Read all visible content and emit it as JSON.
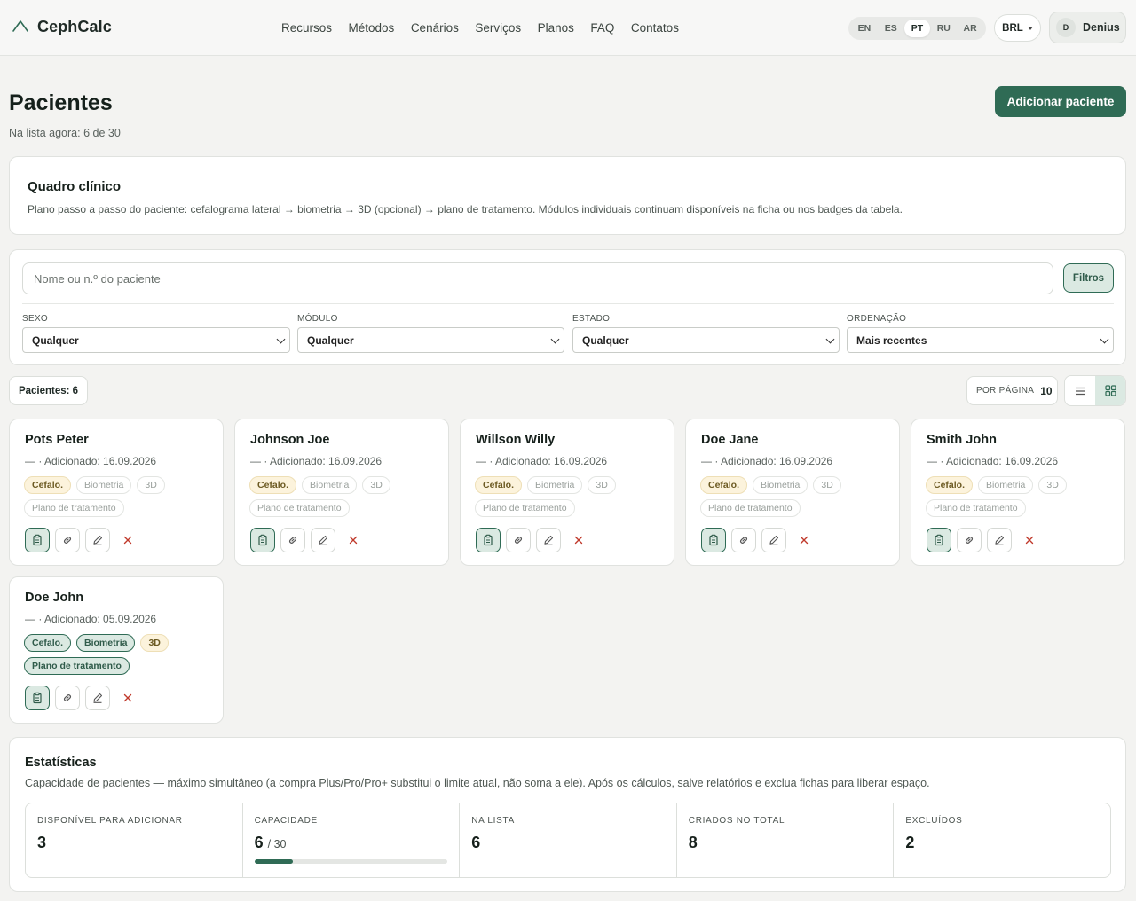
{
  "brand": {
    "name": "CephCalc"
  },
  "nav": [
    "Recursos",
    "Métodos",
    "Cenários",
    "Serviços",
    "Planos",
    "FAQ",
    "Contatos"
  ],
  "languages": {
    "items": [
      "EN",
      "ES",
      "PT",
      "RU",
      "AR"
    ],
    "active": "PT"
  },
  "currency": "BRL",
  "user": {
    "initial": "D",
    "name": "Denius"
  },
  "page": {
    "title": "Pacientes",
    "subtitle": "Na lista agora: 6 de 30",
    "add_button": "Adicionar paciente"
  },
  "clinical": {
    "title": "Quadro clínico",
    "text": "Plano passo a passo do paciente: cefalograma lateral → biometria → 3D (opcional) → plano de tratamento. Módulos individuais continuam disponíveis na ficha ou nos badges da tabela."
  },
  "filters": {
    "search_placeholder": "Nome ou n.º do paciente",
    "button": "Filtros",
    "sex": {
      "label": "SEXO",
      "value": "Qualquer"
    },
    "module": {
      "label": "MÓDULO",
      "value": "Qualquer"
    },
    "state": {
      "label": "ESTADO",
      "value": "Qualquer"
    },
    "order": {
      "label": "ORDENAÇÃO",
      "value": "Mais recentes"
    }
  },
  "list": {
    "count": "Pacientes: 6",
    "per_page_label": "POR PÁGINA",
    "per_page_value": "10",
    "view": "grid"
  },
  "patients": [
    {
      "name": "Pots Peter",
      "meta": "— · Adicionado: 16.09.2026",
      "badges": [
        {
          "label": "Cefalo.",
          "state": "warn"
        },
        {
          "label": "Biometria",
          "state": "off"
        },
        {
          "label": "3D",
          "state": "off"
        },
        {
          "label": "Plano de tratamento",
          "state": "off"
        }
      ]
    },
    {
      "name": "Johnson Joe",
      "meta": "— · Adicionado: 16.09.2026",
      "badges": [
        {
          "label": "Cefalo.",
          "state": "warn"
        },
        {
          "label": "Biometria",
          "state": "off"
        },
        {
          "label": "3D",
          "state": "off"
        },
        {
          "label": "Plano de tratamento",
          "state": "off"
        }
      ]
    },
    {
      "name": "Willson Willy",
      "meta": "— · Adicionado: 16.09.2026",
      "badges": [
        {
          "label": "Cefalo.",
          "state": "warn"
        },
        {
          "label": "Biometria",
          "state": "off"
        },
        {
          "label": "3D",
          "state": "off"
        },
        {
          "label": "Plano de tratamento",
          "state": "off"
        }
      ]
    },
    {
      "name": "Doe Jane",
      "meta": "— · Adicionado: 16.09.2026",
      "badges": [
        {
          "label": "Cefalo.",
          "state": "warn"
        },
        {
          "label": "Biometria",
          "state": "off"
        },
        {
          "label": "3D",
          "state": "off"
        },
        {
          "label": "Plano de tratamento",
          "state": "off"
        }
      ]
    },
    {
      "name": "Smith John",
      "meta": "— · Adicionado: 16.09.2026",
      "badges": [
        {
          "label": "Cefalo.",
          "state": "warn"
        },
        {
          "label": "Biometria",
          "state": "off"
        },
        {
          "label": "3D",
          "state": "off"
        },
        {
          "label": "Plano de tratamento",
          "state": "off"
        }
      ]
    },
    {
      "name": "Doe John",
      "meta": "— · Adicionado: 05.09.2026",
      "badges": [
        {
          "label": "Cefalo.",
          "state": "done"
        },
        {
          "label": "Biometria",
          "state": "done"
        },
        {
          "label": "3D",
          "state": "warn"
        },
        {
          "label": "Plano de tratamento",
          "state": "done"
        }
      ]
    }
  ],
  "stats": {
    "title": "Estatísticas",
    "text": "Capacidade de pacientes — máximo simultâneo (a compra Plus/Pro/Pro+ substitui o limite atual, não soma a ele). Após os cálculos, salve relatórios e exclua fichas para liberar espaço.",
    "cells": [
      {
        "label": "DISPONÍVEL PARA ADICIONAR",
        "value": "3"
      },
      {
        "label": "CAPACIDADE",
        "value": "6",
        "sub": "/ 30",
        "progress": 0.2
      },
      {
        "label": "NA LISTA",
        "value": "6"
      },
      {
        "label": "CRIADOS NO TOTAL",
        "value": "8"
      },
      {
        "label": "EXCLUÍDOS",
        "value": "2"
      }
    ]
  },
  "colors": {
    "accent": "#2f6b55",
    "accent_soft": "#dbe9e2",
    "warn_soft": "#fcf3dc",
    "danger": "#c0392b"
  }
}
